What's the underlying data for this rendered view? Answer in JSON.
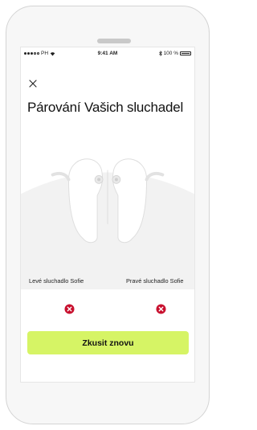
{
  "status_bar": {
    "carrier": "PH",
    "time": "9:41 AM",
    "battery": "100 %",
    "battery_level": 1.0
  },
  "header": {
    "close_icon": "close-icon"
  },
  "title": "Párování Vašich sluchadel",
  "devices": [
    {
      "label": "Levé sluchadlo Sofie",
      "status": "error"
    },
    {
      "label": "Pravé sluchadlo Sofie",
      "status": "error"
    }
  ],
  "actions": {
    "retry_label": "Zkusit znovu"
  },
  "colors": {
    "accent": "#d6f465",
    "error": "#c8102e",
    "hero_background": "#f2f2f2"
  }
}
